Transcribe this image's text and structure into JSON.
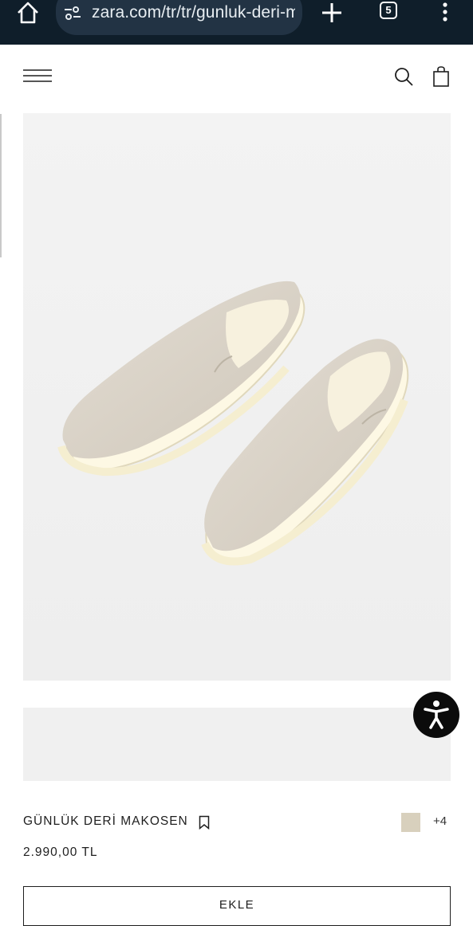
{
  "browser": {
    "url": "zara.com/tr/tr/gunluk-deri-m",
    "tab_count": "5"
  },
  "product": {
    "name": "GÜNLÜK DERİ MAKOSEN",
    "price": "2.990,00 TL",
    "more_colors": "+4",
    "swatch_color": "#d8d0bd",
    "add_label": "EKLE"
  },
  "icons": {
    "home": "home-icon",
    "site_settings": "tune-icon",
    "new_tab": "plus-icon",
    "tabs": "tab-switcher-icon",
    "menu": "more-vert-icon",
    "hamburger": "hamburger-menu-icon",
    "search": "search-icon",
    "bag": "shopping-bag-icon",
    "bookmark": "bookmark-icon",
    "accessibility": "accessibility-icon"
  }
}
